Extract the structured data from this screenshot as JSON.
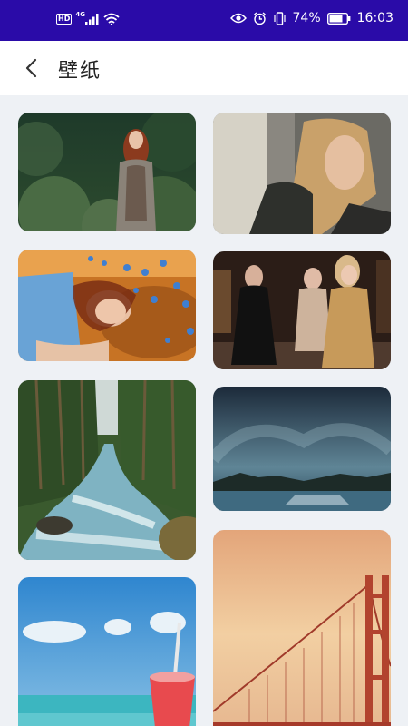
{
  "status_bar": {
    "hd": "HD",
    "network": "4G",
    "battery": "74%",
    "time": "16:03"
  },
  "header": {
    "title": "壁纸"
  },
  "wallpapers": [
    {
      "scene": "woman-in-forest"
    },
    {
      "scene": "woman-portrait-dark"
    },
    {
      "scene": "woman-in-flower-field"
    },
    {
      "scene": "three-women-with-drinks"
    },
    {
      "scene": "forest-river"
    },
    {
      "scene": "night-lake"
    },
    {
      "scene": "beach-drink"
    },
    {
      "scene": "golden-gate-bridge"
    }
  ]
}
